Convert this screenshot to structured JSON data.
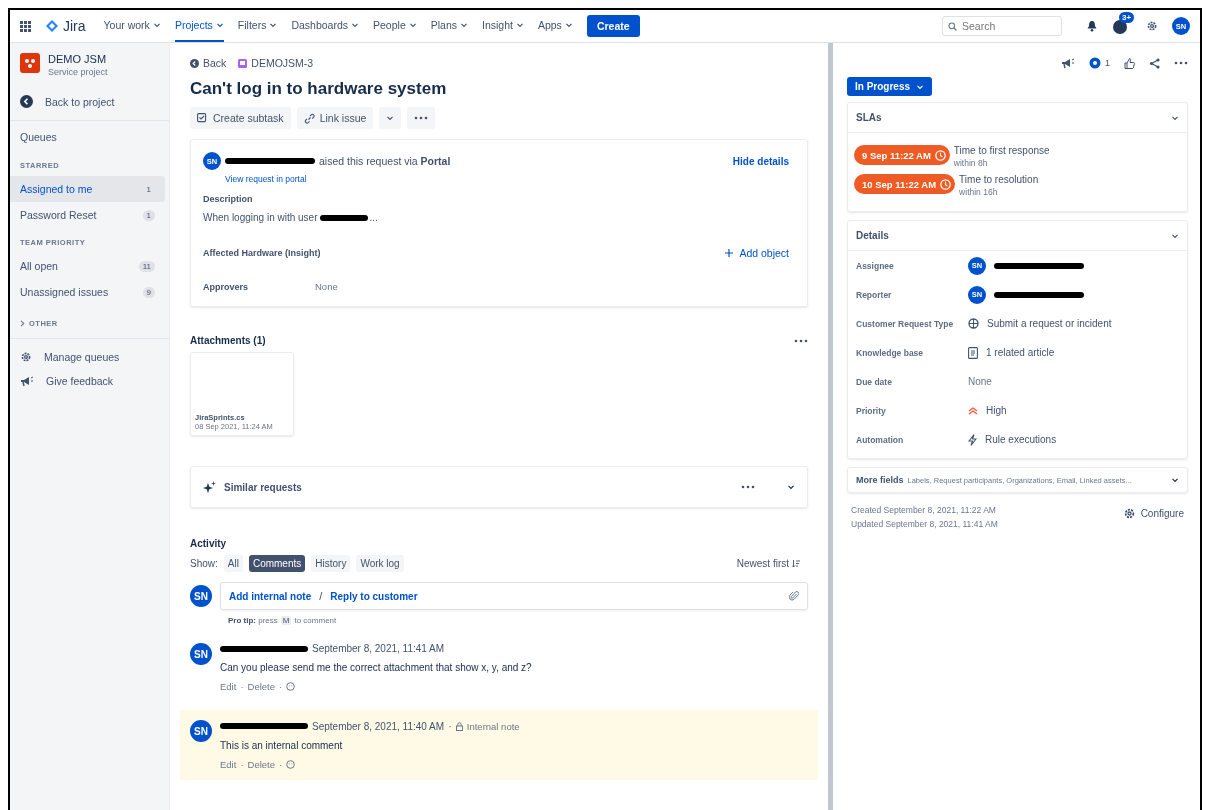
{
  "nav": {
    "logo": "Jira",
    "items": [
      {
        "label": "Your work",
        "selected": false
      },
      {
        "label": "Projects",
        "selected": true
      },
      {
        "label": "Filters",
        "selected": false
      },
      {
        "label": "Dashboards",
        "selected": false
      },
      {
        "label": "People",
        "selected": false
      },
      {
        "label": "Plans",
        "selected": false
      },
      {
        "label": "Insight",
        "selected": false
      },
      {
        "label": "Apps",
        "selected": false
      }
    ],
    "create": "Create",
    "search": {
      "placeholder": "Search"
    },
    "help_badge": "3+",
    "avatar": "SN"
  },
  "sidebar": {
    "project": {
      "name": "DEMO JSM",
      "type": "Service project"
    },
    "back": "Back to project",
    "queues_title": "Queues",
    "sections": [
      {
        "title": "STARRED",
        "items": [
          {
            "label": "Assigned to me",
            "count": "1",
            "selected": true
          },
          {
            "label": "Password Reset",
            "count": "1",
            "selected": false
          }
        ]
      },
      {
        "title": "TEAM PRIORITY",
        "items": [
          {
            "label": "All open",
            "count": "11",
            "selected": false
          },
          {
            "label": "Unassigned issues",
            "count": "9",
            "selected": false
          }
        ]
      }
    ],
    "other": "OTHER",
    "footer": [
      {
        "label": "Manage queues",
        "kind": "gear"
      },
      {
        "label": "Give feedback",
        "kind": "megaphone"
      }
    ]
  },
  "issue": {
    "back": "Back",
    "key": "DEMOJSM-3",
    "title": "Can't log in to hardware system",
    "actions": [
      "Create subtask",
      "Link issue"
    ],
    "request": {
      "avatar": "SN",
      "text": "aised this request via **Portal**",
      "link": "View request in portal",
      "hide": "Hide details"
    },
    "description_label": "Description",
    "description": "When logging in with user",
    "description_end": "...",
    "hardware_label": "Affected Hardware (Insight)",
    "add_object": "Add object",
    "approvers_label": "Approvers",
    "approvers_value": "None",
    "attachments": {
      "title": "Attachments (1)",
      "files": [
        {
          "name": "JiraSprints.cs",
          "date": "08 Sep 2021, 11:24 AM"
        }
      ]
    },
    "similar": "Similar requests"
  },
  "activity": {
    "title": "Activity",
    "show": "Show:",
    "filters": [
      {
        "label": "All",
        "selected": false
      },
      {
        "label": "Comments",
        "selected": true
      },
      {
        "label": "History",
        "selected": false
      },
      {
        "label": "Work log",
        "selected": false
      }
    ],
    "sort": "Newest first",
    "avatar": "SN",
    "internal_note_link": "Add internal note",
    "separator": "/",
    "reply_link": "Reply to customer",
    "pro_tip": {
      "lead": "**Pro tip:** press",
      "key": "M",
      "tail": "to comment"
    },
    "comments": [
      {
        "avatar": "SN",
        "date": "September 8, 2021, 11:41 AM",
        "body": "Can you please send me the correct attachment that show x, y, and z?",
        "actions": [
          "Edit",
          "Delete"
        ],
        "separator": "·",
        "internal": false
      },
      {
        "avatar": "SN",
        "date": "September 8, 2021, 11:40 AM",
        "body": "This is an internal comment",
        "actions": [
          "Edit",
          "Delete"
        ],
        "separator": "·",
        "internal": true,
        "internal_label": "Internal note"
      }
    ]
  },
  "panel": {
    "watchers": "1",
    "status": "In Progress",
    "slas": {
      "title": "SLAs",
      "items": [
        {
          "time": "9 Sep 11:22 AM",
          "label": "Time to first response",
          "within": "within 8h"
        },
        {
          "time": "10 Sep 11:22 AM",
          "label": "Time to resolution",
          "within": "within 16h"
        }
      ]
    },
    "details": {
      "title": "Details",
      "fields": [
        {
          "label": "Assignee",
          "kind": "user",
          "avatar": "SN"
        },
        {
          "label": "Reporter",
          "kind": "user",
          "avatar": "SN"
        },
        {
          "label": "Customer Request Type",
          "kind": "request-type",
          "value": "Submit a request or incident"
        },
        {
          "label": "Knowledge base",
          "kind": "article",
          "value": "1 related article"
        },
        {
          "label": "Due date",
          "kind": "empty",
          "value": "None"
        },
        {
          "label": "Priority",
          "kind": "priority",
          "value": "High"
        },
        {
          "label": "Automation",
          "kind": "automation",
          "value": "Rule executions"
        }
      ]
    },
    "more_fields": {
      "title": "More fields",
      "summary": "Labels, Request participants, Organizations, Email, Linked assets..."
    },
    "created": "Created September 8, 2021, 11:22 AM",
    "updated": "Updated September 8, 2021, 11:41 AM",
    "configure": "Configure"
  }
}
